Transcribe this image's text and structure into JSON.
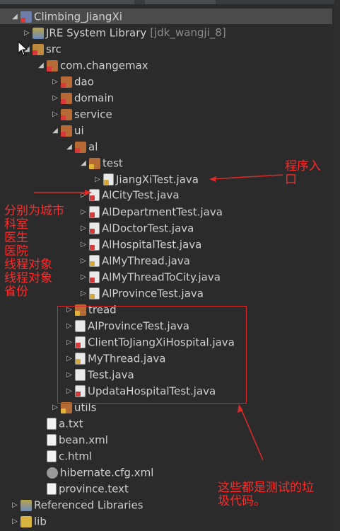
{
  "tree": [
    {
      "label": "Climbing_JiangXi",
      "decoration": "",
      "icon": "project-icon",
      "expanded": true,
      "selected": true
    },
    {
      "label": "JRE System Library",
      "decoration": "[jdk_wangji_8]",
      "icon": "library-icon",
      "expanded": false
    },
    {
      "label": "src",
      "decoration": "",
      "icon": "source-folder-icon",
      "expanded": true
    },
    {
      "label": "com.changemax",
      "decoration": "",
      "icon": "package-icon",
      "expanded": true
    },
    {
      "label": "dao",
      "decoration": "",
      "icon": "package-icon",
      "expanded": false
    },
    {
      "label": "domain",
      "decoration": "",
      "icon": "package-icon",
      "expanded": false
    },
    {
      "label": "service",
      "decoration": "",
      "icon": "package-icon",
      "expanded": false
    },
    {
      "label": "ui",
      "decoration": "",
      "icon": "package-icon",
      "expanded": true
    },
    {
      "label": "al",
      "decoration": "",
      "icon": "package-icon",
      "expanded": true
    },
    {
      "label": "test",
      "decoration": "",
      "icon": "package-icon",
      "expanded": true
    },
    {
      "label": "JiangXiTest.java",
      "decoration": "",
      "icon": "java-file-icon",
      "expanded": false
    },
    {
      "label": "AlCityTest.java",
      "decoration": "",
      "icon": "java-file-icon",
      "expanded": false
    },
    {
      "label": "AlDepartmentTest.java",
      "decoration": "",
      "icon": "java-file-icon",
      "expanded": false
    },
    {
      "label": "AlDoctorTest.java",
      "decoration": "",
      "icon": "java-file-icon",
      "expanded": false
    },
    {
      "label": "AlHospitalTest.java",
      "decoration": "",
      "icon": "java-file-icon",
      "expanded": false
    },
    {
      "label": "AlMyThread.java",
      "decoration": "",
      "icon": "java-file-icon",
      "expanded": false
    },
    {
      "label": "AlMyThreadToCity.java",
      "decoration": "",
      "icon": "java-file-icon",
      "expanded": false
    },
    {
      "label": "AlProvinceTest.java",
      "decoration": "",
      "icon": "java-file-icon",
      "expanded": false
    },
    {
      "label": "tread",
      "decoration": "",
      "icon": "package-icon",
      "expanded": false
    },
    {
      "label": "AlProvinceTest.java",
      "decoration": "",
      "icon": "java-file-icon",
      "expanded": false
    },
    {
      "label": "ClientToJiangXiHospital.java",
      "decoration": "",
      "icon": "java-file-icon",
      "expanded": false
    },
    {
      "label": "MyThread.java",
      "decoration": "",
      "icon": "java-file-icon",
      "expanded": false
    },
    {
      "label": "Test.java",
      "decoration": "",
      "icon": "java-file-icon",
      "expanded": false
    },
    {
      "label": "UpdataHospitalTest.java",
      "decoration": "",
      "icon": "java-file-icon",
      "expanded": false
    },
    {
      "label": "utils",
      "decoration": "",
      "icon": "package-icon",
      "expanded": false
    },
    {
      "label": "a.txt",
      "decoration": "",
      "icon": "text-file-icon"
    },
    {
      "label": "bean.xml",
      "decoration": "",
      "icon": "xml-file-icon"
    },
    {
      "label": "c.html",
      "decoration": "",
      "icon": "html-file-icon"
    },
    {
      "label": "hibernate.cfg.xml",
      "decoration": "",
      "icon": "config-file-icon"
    },
    {
      "label": "province.text",
      "decoration": "",
      "icon": "text-file-icon"
    },
    {
      "label": "Referenced Libraries",
      "decoration": "",
      "icon": "library-icon",
      "expanded": false
    },
    {
      "label": "lib",
      "decoration": "",
      "icon": "folder-icon",
      "expanded": false
    }
  ],
  "annotations": {
    "entry_label": [
      "程序入",
      "口"
    ],
    "left_labels": [
      "分别为城市",
      "科室",
      "医生",
      "医院",
      "线程对象",
      "线程对象",
      "省份"
    ],
    "garbage_label": [
      "这些都是测试的垃",
      "圾代码。"
    ]
  },
  "colors": {
    "background": "#2b2b2b",
    "text": "#cfcfcf",
    "annotation": "#ff2a2a",
    "selection": "#4b4b4b"
  }
}
